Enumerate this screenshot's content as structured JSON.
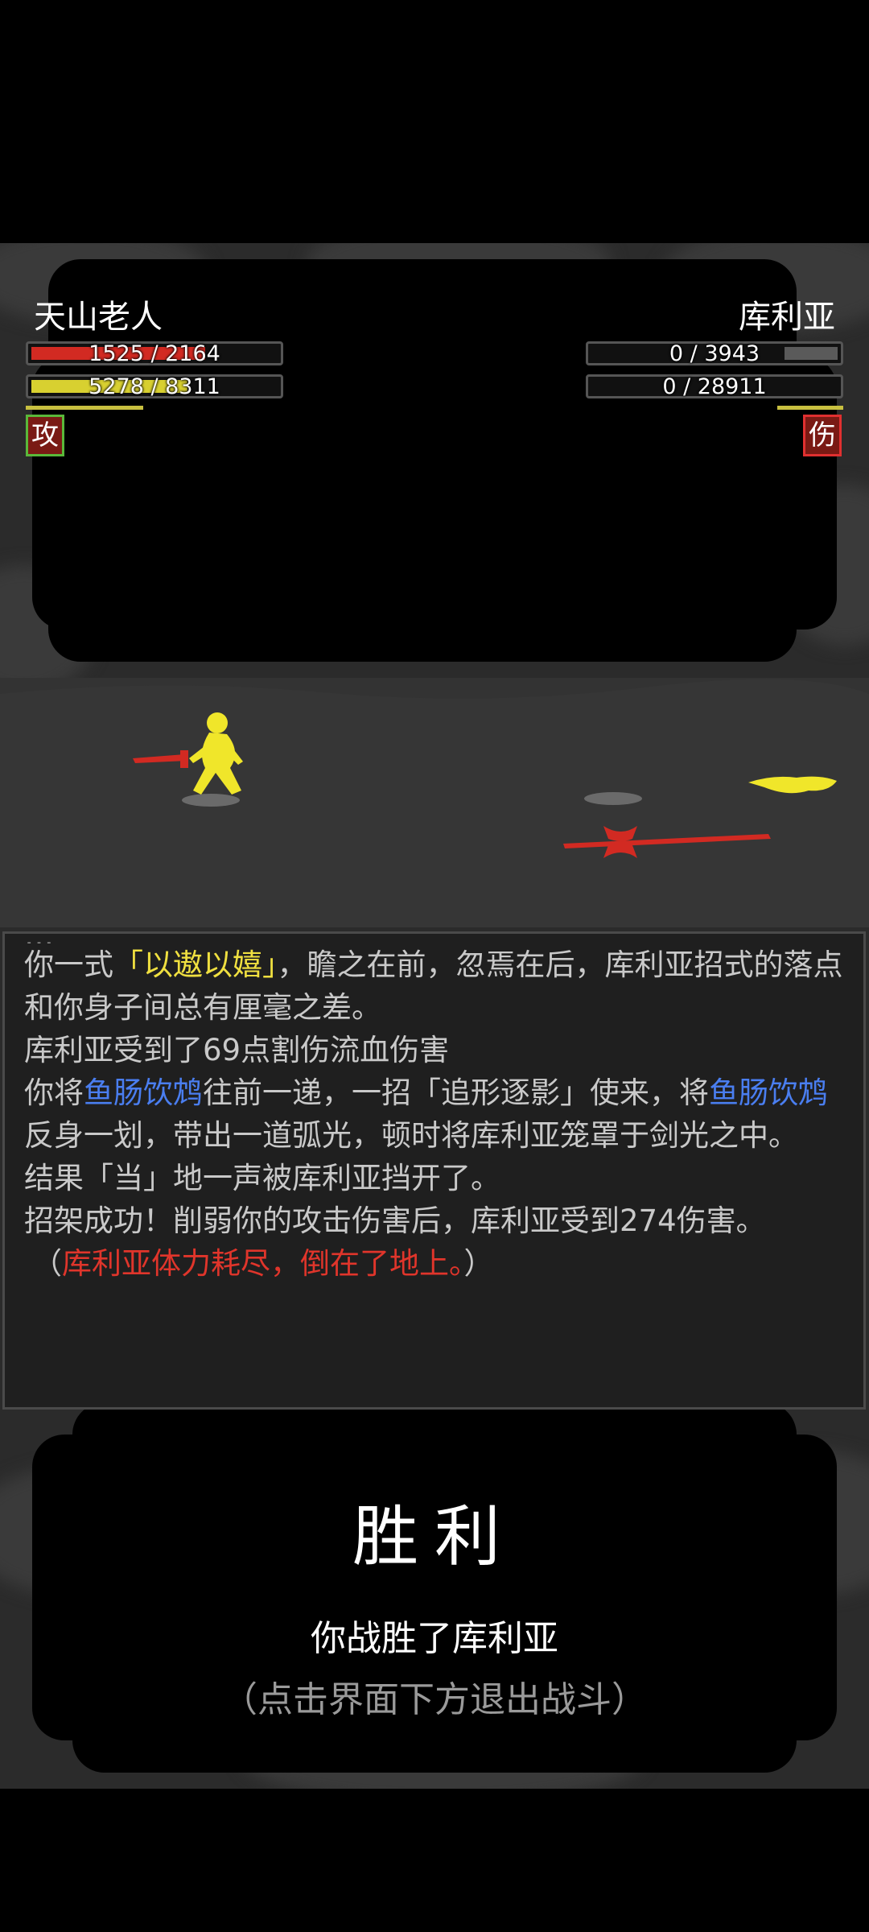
{
  "player": {
    "name": "天山老人",
    "hp_text": "1525 / 2164",
    "hp_fraction": 0.705,
    "mp_text": "5278 / 8311",
    "mp_fraction": 0.635,
    "stance_badge": "攻",
    "hp_color": "#d22a22",
    "mp_color": "#d8d030"
  },
  "enemy": {
    "name": "库利亚",
    "hp_text": "0 / 3943",
    "hp_fraction": 0,
    "mp_text": "0 / 28911",
    "mp_fraction": 0,
    "status_badge": "伤"
  },
  "log": {
    "line1_a": "你一式",
    "line1_skill": "「以遨以嬉」",
    "line1_b": "，瞻之在前，忽焉在后，库利亚招式的落点和你身子间总有厘毫之差。",
    "line2": "库利亚受到了69点割伤流血伤害",
    "line3_a": "你将",
    "line3_weapon1": "鱼肠饮鸩",
    "line3_b": "往前一递，一招「追形逐影」使来，将",
    "line3_weapon2": "鱼肠饮鸩",
    "line3_c": "反身一划，带出一道弧光，顿时将库利亚笼罩于剑光之中。",
    "line4": "结果「当」地一声被库利亚挡开了。",
    "line5": "招架成功！削弱你的攻击伤害后，库利亚受到274伤害。",
    "line6_open": "（",
    "line6_red": "库利亚体力耗尽，倒在了地上。",
    "line6_close": "）"
  },
  "result": {
    "title": "胜利",
    "subtitle": "你战胜了库利亚",
    "hint": "（点击界面下方退出战斗）"
  }
}
